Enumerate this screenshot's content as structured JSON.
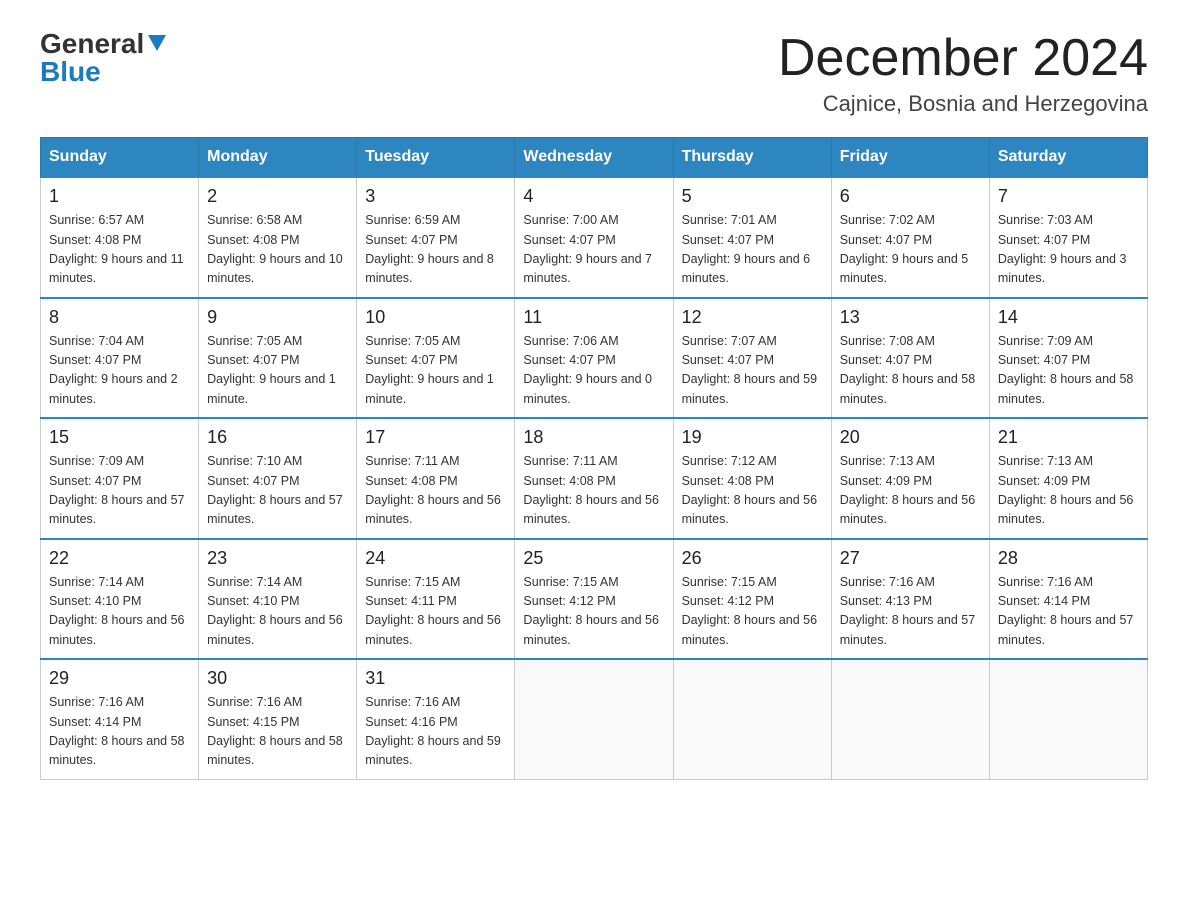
{
  "header": {
    "logo_general": "General",
    "logo_blue": "Blue",
    "title": "December 2024",
    "subtitle": "Cajnice, Bosnia and Herzegovina"
  },
  "days_of_week": [
    "Sunday",
    "Monday",
    "Tuesday",
    "Wednesday",
    "Thursday",
    "Friday",
    "Saturday"
  ],
  "weeks": [
    [
      {
        "day": 1,
        "sunrise": "6:57 AM",
        "sunset": "4:08 PM",
        "daylight": "9 hours and 11 minutes."
      },
      {
        "day": 2,
        "sunrise": "6:58 AM",
        "sunset": "4:08 PM",
        "daylight": "9 hours and 10 minutes."
      },
      {
        "day": 3,
        "sunrise": "6:59 AM",
        "sunset": "4:07 PM",
        "daylight": "9 hours and 8 minutes."
      },
      {
        "day": 4,
        "sunrise": "7:00 AM",
        "sunset": "4:07 PM",
        "daylight": "9 hours and 7 minutes."
      },
      {
        "day": 5,
        "sunrise": "7:01 AM",
        "sunset": "4:07 PM",
        "daylight": "9 hours and 6 minutes."
      },
      {
        "day": 6,
        "sunrise": "7:02 AM",
        "sunset": "4:07 PM",
        "daylight": "9 hours and 5 minutes."
      },
      {
        "day": 7,
        "sunrise": "7:03 AM",
        "sunset": "4:07 PM",
        "daylight": "9 hours and 3 minutes."
      }
    ],
    [
      {
        "day": 8,
        "sunrise": "7:04 AM",
        "sunset": "4:07 PM",
        "daylight": "9 hours and 2 minutes."
      },
      {
        "day": 9,
        "sunrise": "7:05 AM",
        "sunset": "4:07 PM",
        "daylight": "9 hours and 1 minute."
      },
      {
        "day": 10,
        "sunrise": "7:05 AM",
        "sunset": "4:07 PM",
        "daylight": "9 hours and 1 minute."
      },
      {
        "day": 11,
        "sunrise": "7:06 AM",
        "sunset": "4:07 PM",
        "daylight": "9 hours and 0 minutes."
      },
      {
        "day": 12,
        "sunrise": "7:07 AM",
        "sunset": "4:07 PM",
        "daylight": "8 hours and 59 minutes."
      },
      {
        "day": 13,
        "sunrise": "7:08 AM",
        "sunset": "4:07 PM",
        "daylight": "8 hours and 58 minutes."
      },
      {
        "day": 14,
        "sunrise": "7:09 AM",
        "sunset": "4:07 PM",
        "daylight": "8 hours and 58 minutes."
      }
    ],
    [
      {
        "day": 15,
        "sunrise": "7:09 AM",
        "sunset": "4:07 PM",
        "daylight": "8 hours and 57 minutes."
      },
      {
        "day": 16,
        "sunrise": "7:10 AM",
        "sunset": "4:07 PM",
        "daylight": "8 hours and 57 minutes."
      },
      {
        "day": 17,
        "sunrise": "7:11 AM",
        "sunset": "4:08 PM",
        "daylight": "8 hours and 56 minutes."
      },
      {
        "day": 18,
        "sunrise": "7:11 AM",
        "sunset": "4:08 PM",
        "daylight": "8 hours and 56 minutes."
      },
      {
        "day": 19,
        "sunrise": "7:12 AM",
        "sunset": "4:08 PM",
        "daylight": "8 hours and 56 minutes."
      },
      {
        "day": 20,
        "sunrise": "7:13 AM",
        "sunset": "4:09 PM",
        "daylight": "8 hours and 56 minutes."
      },
      {
        "day": 21,
        "sunrise": "7:13 AM",
        "sunset": "4:09 PM",
        "daylight": "8 hours and 56 minutes."
      }
    ],
    [
      {
        "day": 22,
        "sunrise": "7:14 AM",
        "sunset": "4:10 PM",
        "daylight": "8 hours and 56 minutes."
      },
      {
        "day": 23,
        "sunrise": "7:14 AM",
        "sunset": "4:10 PM",
        "daylight": "8 hours and 56 minutes."
      },
      {
        "day": 24,
        "sunrise": "7:15 AM",
        "sunset": "4:11 PM",
        "daylight": "8 hours and 56 minutes."
      },
      {
        "day": 25,
        "sunrise": "7:15 AM",
        "sunset": "4:12 PM",
        "daylight": "8 hours and 56 minutes."
      },
      {
        "day": 26,
        "sunrise": "7:15 AM",
        "sunset": "4:12 PM",
        "daylight": "8 hours and 56 minutes."
      },
      {
        "day": 27,
        "sunrise": "7:16 AM",
        "sunset": "4:13 PM",
        "daylight": "8 hours and 57 minutes."
      },
      {
        "day": 28,
        "sunrise": "7:16 AM",
        "sunset": "4:14 PM",
        "daylight": "8 hours and 57 minutes."
      }
    ],
    [
      {
        "day": 29,
        "sunrise": "7:16 AM",
        "sunset": "4:14 PM",
        "daylight": "8 hours and 58 minutes."
      },
      {
        "day": 30,
        "sunrise": "7:16 AM",
        "sunset": "4:15 PM",
        "daylight": "8 hours and 58 minutes."
      },
      {
        "day": 31,
        "sunrise": "7:16 AM",
        "sunset": "4:16 PM",
        "daylight": "8 hours and 59 minutes."
      },
      null,
      null,
      null,
      null
    ]
  ]
}
